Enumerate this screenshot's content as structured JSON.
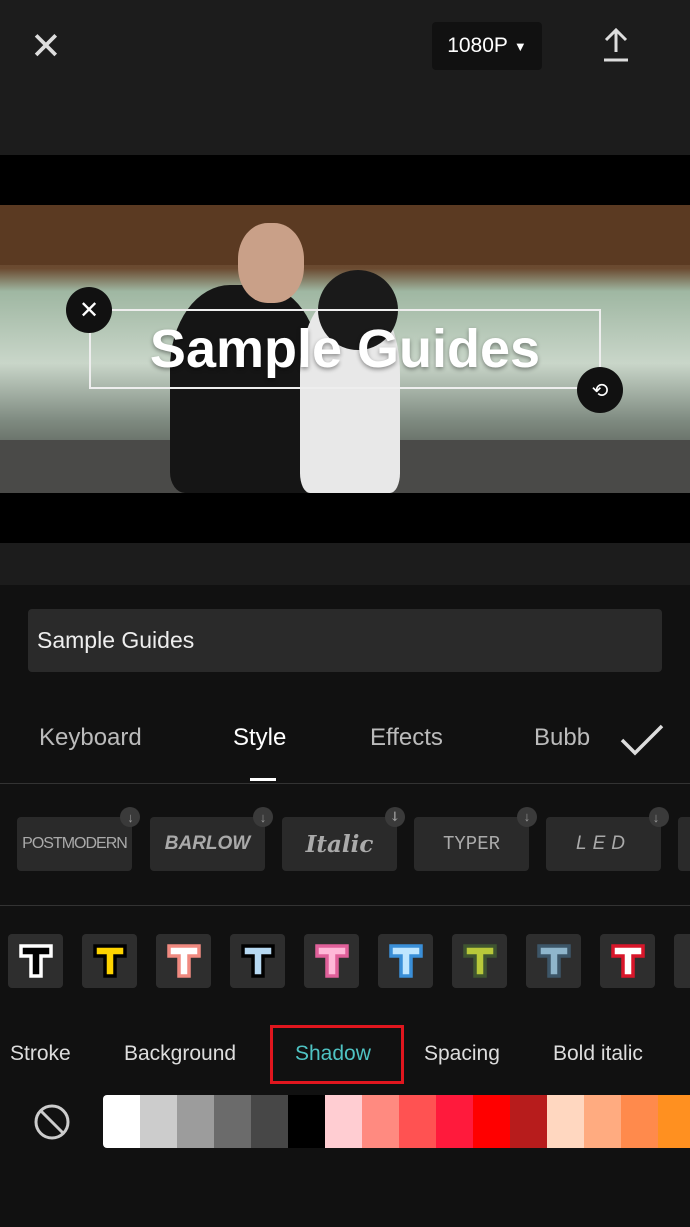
{
  "header": {
    "resolution": "1080P"
  },
  "video": {
    "overlay_text": "Sample Guides"
  },
  "text_input": {
    "value": "Sample Guides"
  },
  "tabs": [
    {
      "label": "Keyboard"
    },
    {
      "label": "Style",
      "active": true
    },
    {
      "label": "Effects"
    },
    {
      "label": "Bubb"
    }
  ],
  "fonts": [
    "POSTMODERN",
    "BARLOW",
    "Italic",
    "TYPER",
    "LED"
  ],
  "text_styles": [
    {
      "fill": "#000000",
      "stroke": "#ffffff"
    },
    {
      "fill": "#ffd400",
      "stroke": "#000000"
    },
    {
      "fill": "#ffffff",
      "stroke": "#f08a80"
    },
    {
      "fill": "#b7d9f2",
      "stroke": "#000000"
    },
    {
      "fill": "#ffb8d8",
      "stroke": "#e0609a"
    },
    {
      "fill": "#bfe6ff",
      "stroke": "#3a8fd8"
    },
    {
      "fill": "#b8c83a",
      "stroke": "#3f5530"
    },
    {
      "fill": "#8fb6cc",
      "stroke": "#3d5668"
    },
    {
      "fill": "#ffffff",
      "stroke": "#d8162a"
    }
  ],
  "style_options": [
    {
      "label": "Stroke"
    },
    {
      "label": "Background"
    },
    {
      "label": "Shadow",
      "selected": true
    },
    {
      "label": "Spacing"
    },
    {
      "label": "Bold italic"
    }
  ],
  "accent_color": "#4fc3c3",
  "highlight_color": "#e0161e",
  "swatches": [
    "#ffffff",
    "#cccccc",
    "#9c9c9c",
    "#6b6b6b",
    "#474747",
    "#000000",
    "#ffcdd2",
    "#ff8a80",
    "#ff5252",
    "#ff1a3c",
    "#ff0000",
    "#b71c1c",
    "#ffd7c0",
    "#ffab80",
    "#ff8a4c",
    "#ff9020"
  ]
}
